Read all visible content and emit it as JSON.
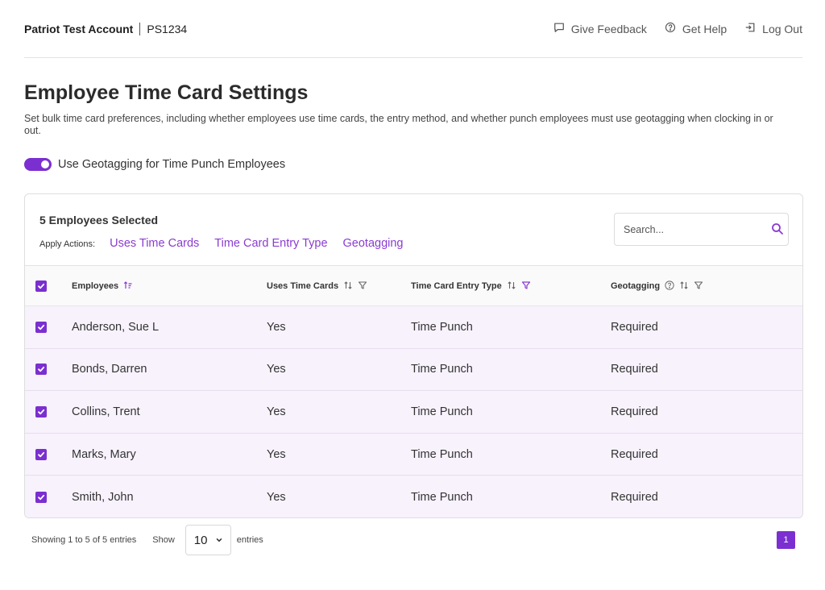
{
  "header": {
    "account_name": "Patriot Test Account",
    "account_id": "PS1234",
    "links": [
      {
        "label": "Give Feedback",
        "icon": "feedback-icon"
      },
      {
        "label": "Get Help",
        "icon": "help-icon"
      },
      {
        "label": "Log Out",
        "icon": "logout-icon"
      }
    ]
  },
  "page": {
    "title": "Employee Time Card Settings",
    "description": "Set bulk time card preferences, including whether employees use time cards, the entry method, and whether punch employees must use geotagging when clocking in or out."
  },
  "geotag_toggle": {
    "label": "Use Geotagging for Time Punch Employees",
    "on": true
  },
  "panel": {
    "selected_text": "5 Employees Selected",
    "apply_label": "Apply Actions:",
    "actions": [
      "Uses Time Cards",
      "Time Card Entry Type",
      "Geotagging"
    ],
    "search_placeholder": "Search..."
  },
  "table": {
    "columns": [
      "Employees",
      "Uses Time Cards",
      "Time Card Entry Type",
      "Geotagging"
    ],
    "rows": [
      {
        "name": "Anderson, Sue L",
        "uses": "Yes",
        "entry": "Time Punch",
        "geo": "Required",
        "checked": true
      },
      {
        "name": "Bonds, Darren",
        "uses": "Yes",
        "entry": "Time Punch",
        "geo": "Required",
        "checked": true
      },
      {
        "name": "Collins, Trent",
        "uses": "Yes",
        "entry": "Time Punch",
        "geo": "Required",
        "checked": true
      },
      {
        "name": "Marks, Mary",
        "uses": "Yes",
        "entry": "Time Punch",
        "geo": "Required",
        "checked": true
      },
      {
        "name": "Smith, John",
        "uses": "Yes",
        "entry": "Time Punch",
        "geo": "Required",
        "checked": true
      }
    ]
  },
  "footer": {
    "showing_text": "Showing 1 to 5 of 5 entries",
    "show_label": "Show",
    "page_size": "10",
    "entries_label": "entries",
    "current_page": "1"
  },
  "colors": {
    "accent": "#7b2fd0",
    "row_bg": "#f8f2fd"
  }
}
